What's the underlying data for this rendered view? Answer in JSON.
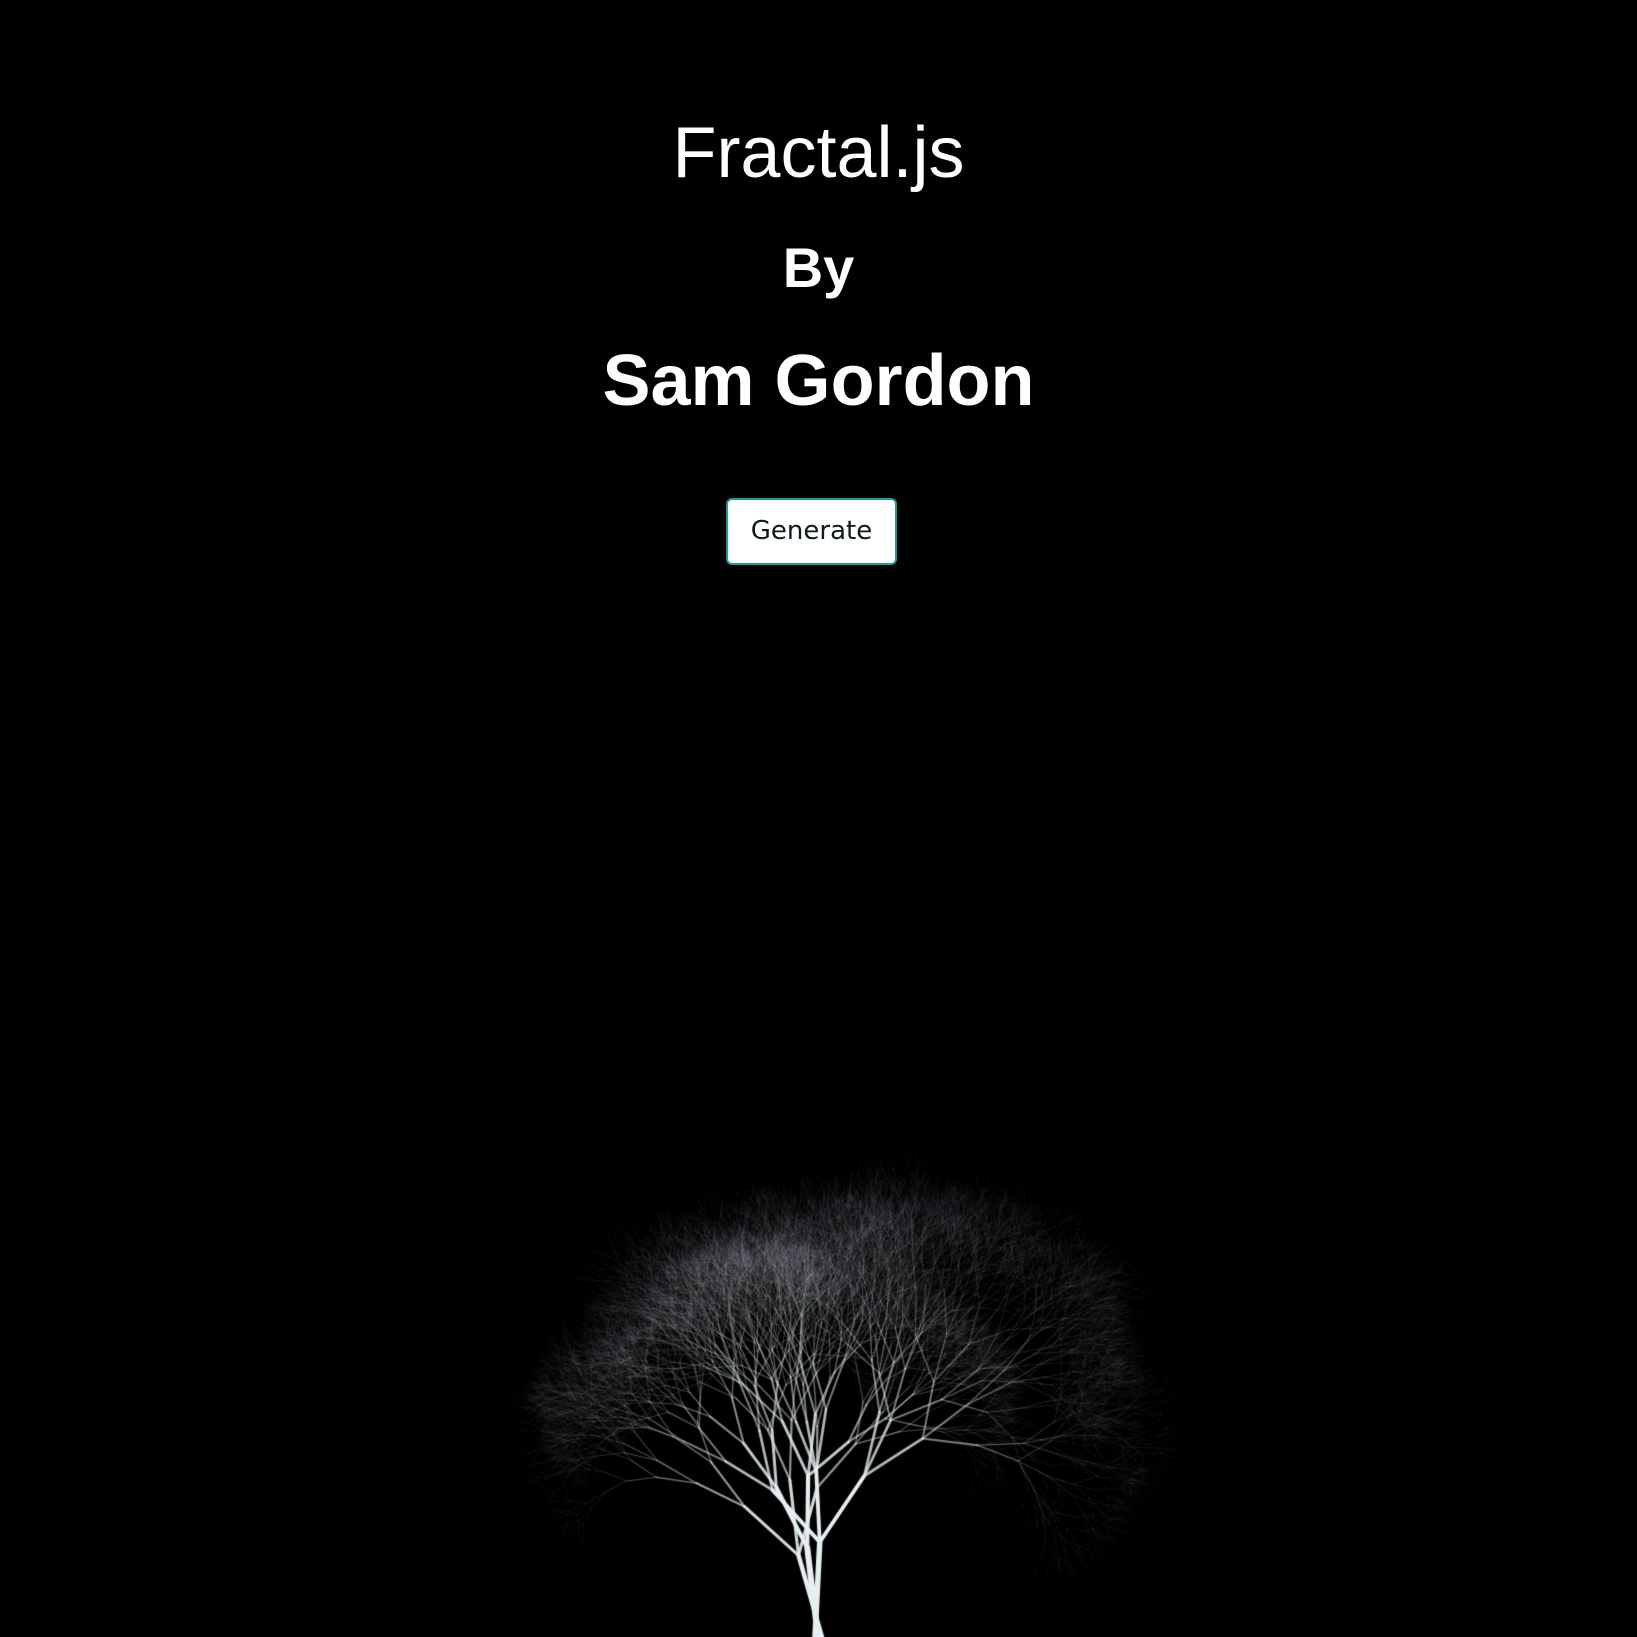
{
  "header": {
    "title": "Fractal.js",
    "by": "By",
    "author": "Sam Gordon"
  },
  "controls": {
    "generate_label": "Generate"
  },
  "colors": {
    "background": "#000000",
    "text": "#ffffff",
    "branch": "#e6eef2",
    "button_border": "#1a9c9c"
  }
}
